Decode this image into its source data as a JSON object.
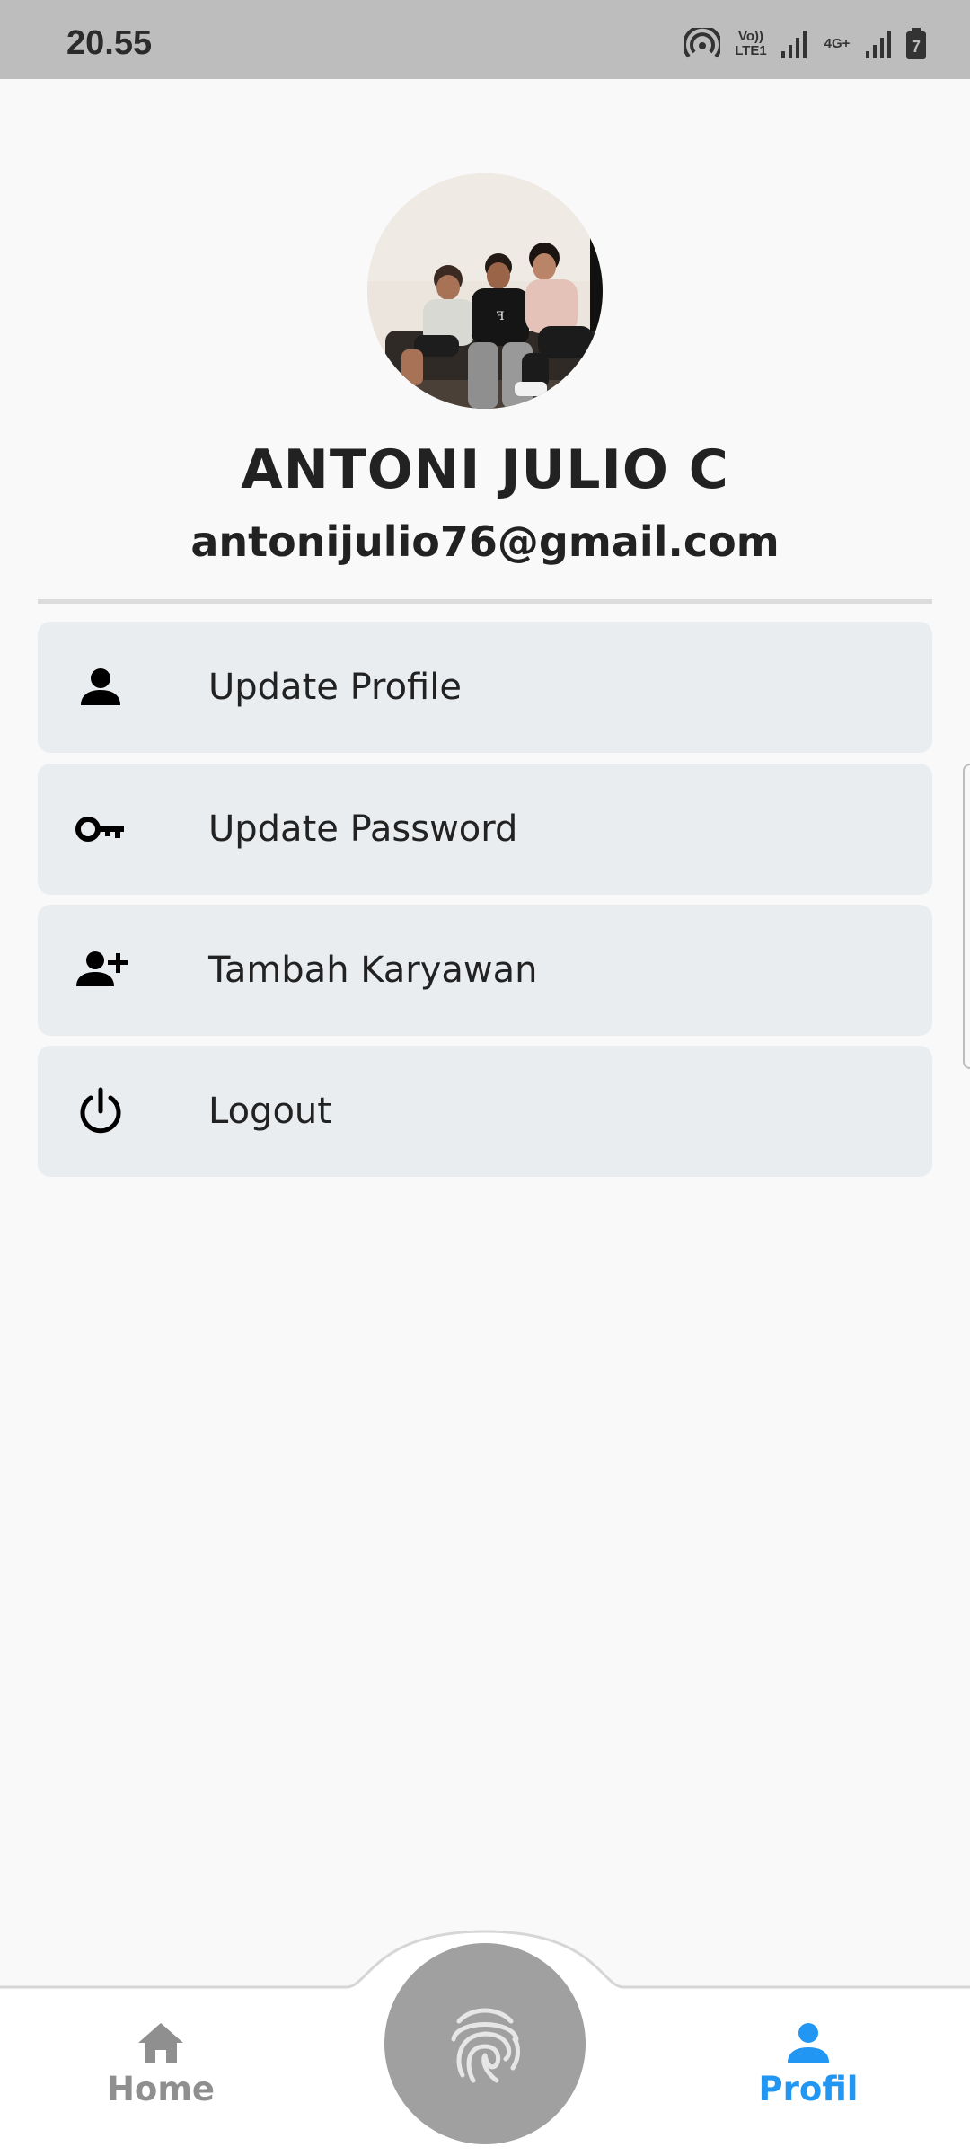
{
  "status_bar": {
    "time": "20.55",
    "net_1": "Vo)) LTE1",
    "net_2": "4G+",
    "battery_level": "7"
  },
  "profile": {
    "name": "ANTONI JULIO C",
    "email": "antonijulio76@gmail.com"
  },
  "menu": {
    "items": [
      {
        "label": "Update Profile",
        "icon": "person-icon"
      },
      {
        "label": "Update Password",
        "icon": "key-icon"
      },
      {
        "label": "Tambah Karyawan",
        "icon": "person-add-icon"
      },
      {
        "label": "Logout",
        "icon": "power-icon"
      }
    ]
  },
  "bottom_nav": {
    "home_label": "Home",
    "profil_label": "Profil",
    "active": "Profil",
    "active_color": "#2196f3",
    "inactive_color": "#8f8f8f"
  }
}
